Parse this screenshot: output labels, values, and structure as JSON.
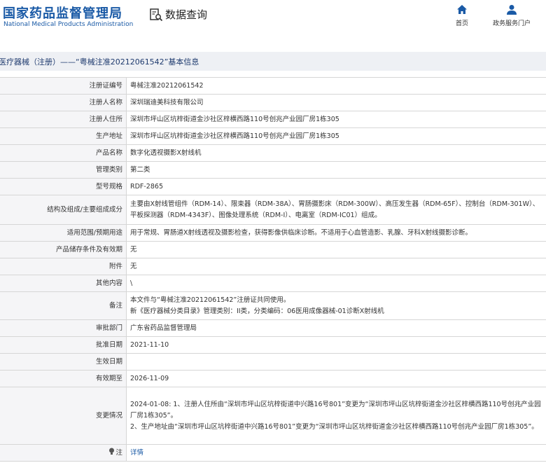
{
  "header": {
    "logo_cn": "国家药品监督管理局",
    "logo_en": "National Medical Products Administration",
    "query_label": "数据查询",
    "nav": [
      {
        "label": "首页",
        "icon": "home-icon"
      },
      {
        "label": "政务服务门户",
        "icon": "user-icon"
      }
    ]
  },
  "title": "医疗器械（注册）——“粤械注准20212061542”基本信息",
  "rows": [
    {
      "key": "注册证编号",
      "value": "粤械注准20212061542"
    },
    {
      "key": "注册人名称",
      "value": "深圳瑞迪美科技有限公司"
    },
    {
      "key": "注册人住所",
      "value": "深圳市坪山区坑梓街道金沙社区梓横西路110号创兆产业园厂房1栋305"
    },
    {
      "key": "生产地址",
      "value": "深圳市坪山区坑梓街道金沙社区梓横西路110号创兆产业园厂房1栋305"
    },
    {
      "key": "产品名称",
      "value": "数字化透视摄影X射线机"
    },
    {
      "key": "管理类别",
      "value": "第二类"
    },
    {
      "key": "型号规格",
      "value": "RDF-2865"
    },
    {
      "key": "结构及组成/主要组成成分",
      "value": "主要由X射线管组件（RDM-14）、限束器（RDM-38A）、胃肠摄影床（RDM-300W）、高压发生器（RDM-65F）、控制台（RDM-301W）、平板探测器（RDM-4343F）、图像处理系统（RDM-I）、电离室（RDM-IC01）组成。"
    },
    {
      "key": "适用范围/预期用途",
      "value": "用于常规、胃肠道X射线透视及摄影检查，获得影像供临床诊断。不适用于心血管造影、乳腺、牙科X射线摄影诊断。"
    },
    {
      "key": "产品储存条件及有效期",
      "value": "无"
    },
    {
      "key": "附件",
      "value": "无"
    },
    {
      "key": "其他内容",
      "value": "\\"
    },
    {
      "key": "备注",
      "value": "本文件与“粤械注准20212061542”注册证共同使用。",
      "value2": "新《医疗器械分类目录》管理类别：II类，分类编码：06医用成像器械-01诊断X射线机"
    },
    {
      "key": "审批部门",
      "value": "广东省药品监督管理局"
    },
    {
      "key": "批准日期",
      "value": "2021-11-10"
    },
    {
      "key": "生效日期",
      "value": ""
    },
    {
      "key": "有效期至",
      "value": "2026-11-09"
    },
    {
      "key": "变更情况",
      "value": "2024-01-08: 1、注册人住所由“深圳市坪山区坑梓街道中兴路16号801”变更为“深圳市坪山区坑梓街道金沙社区梓横西路110号创兆产业园厂房1栋305”。",
      "value2": "2、生产地址由“深圳市坪山区坑梓街道中兴路16号801”变更为“深圳市坪山区坑梓街道金沙社区梓横西路110号创兆产业园厂房1栋305”。"
    },
    {
      "key": "注",
      "value": "详情",
      "icon": "lightbulb-icon"
    }
  ]
}
